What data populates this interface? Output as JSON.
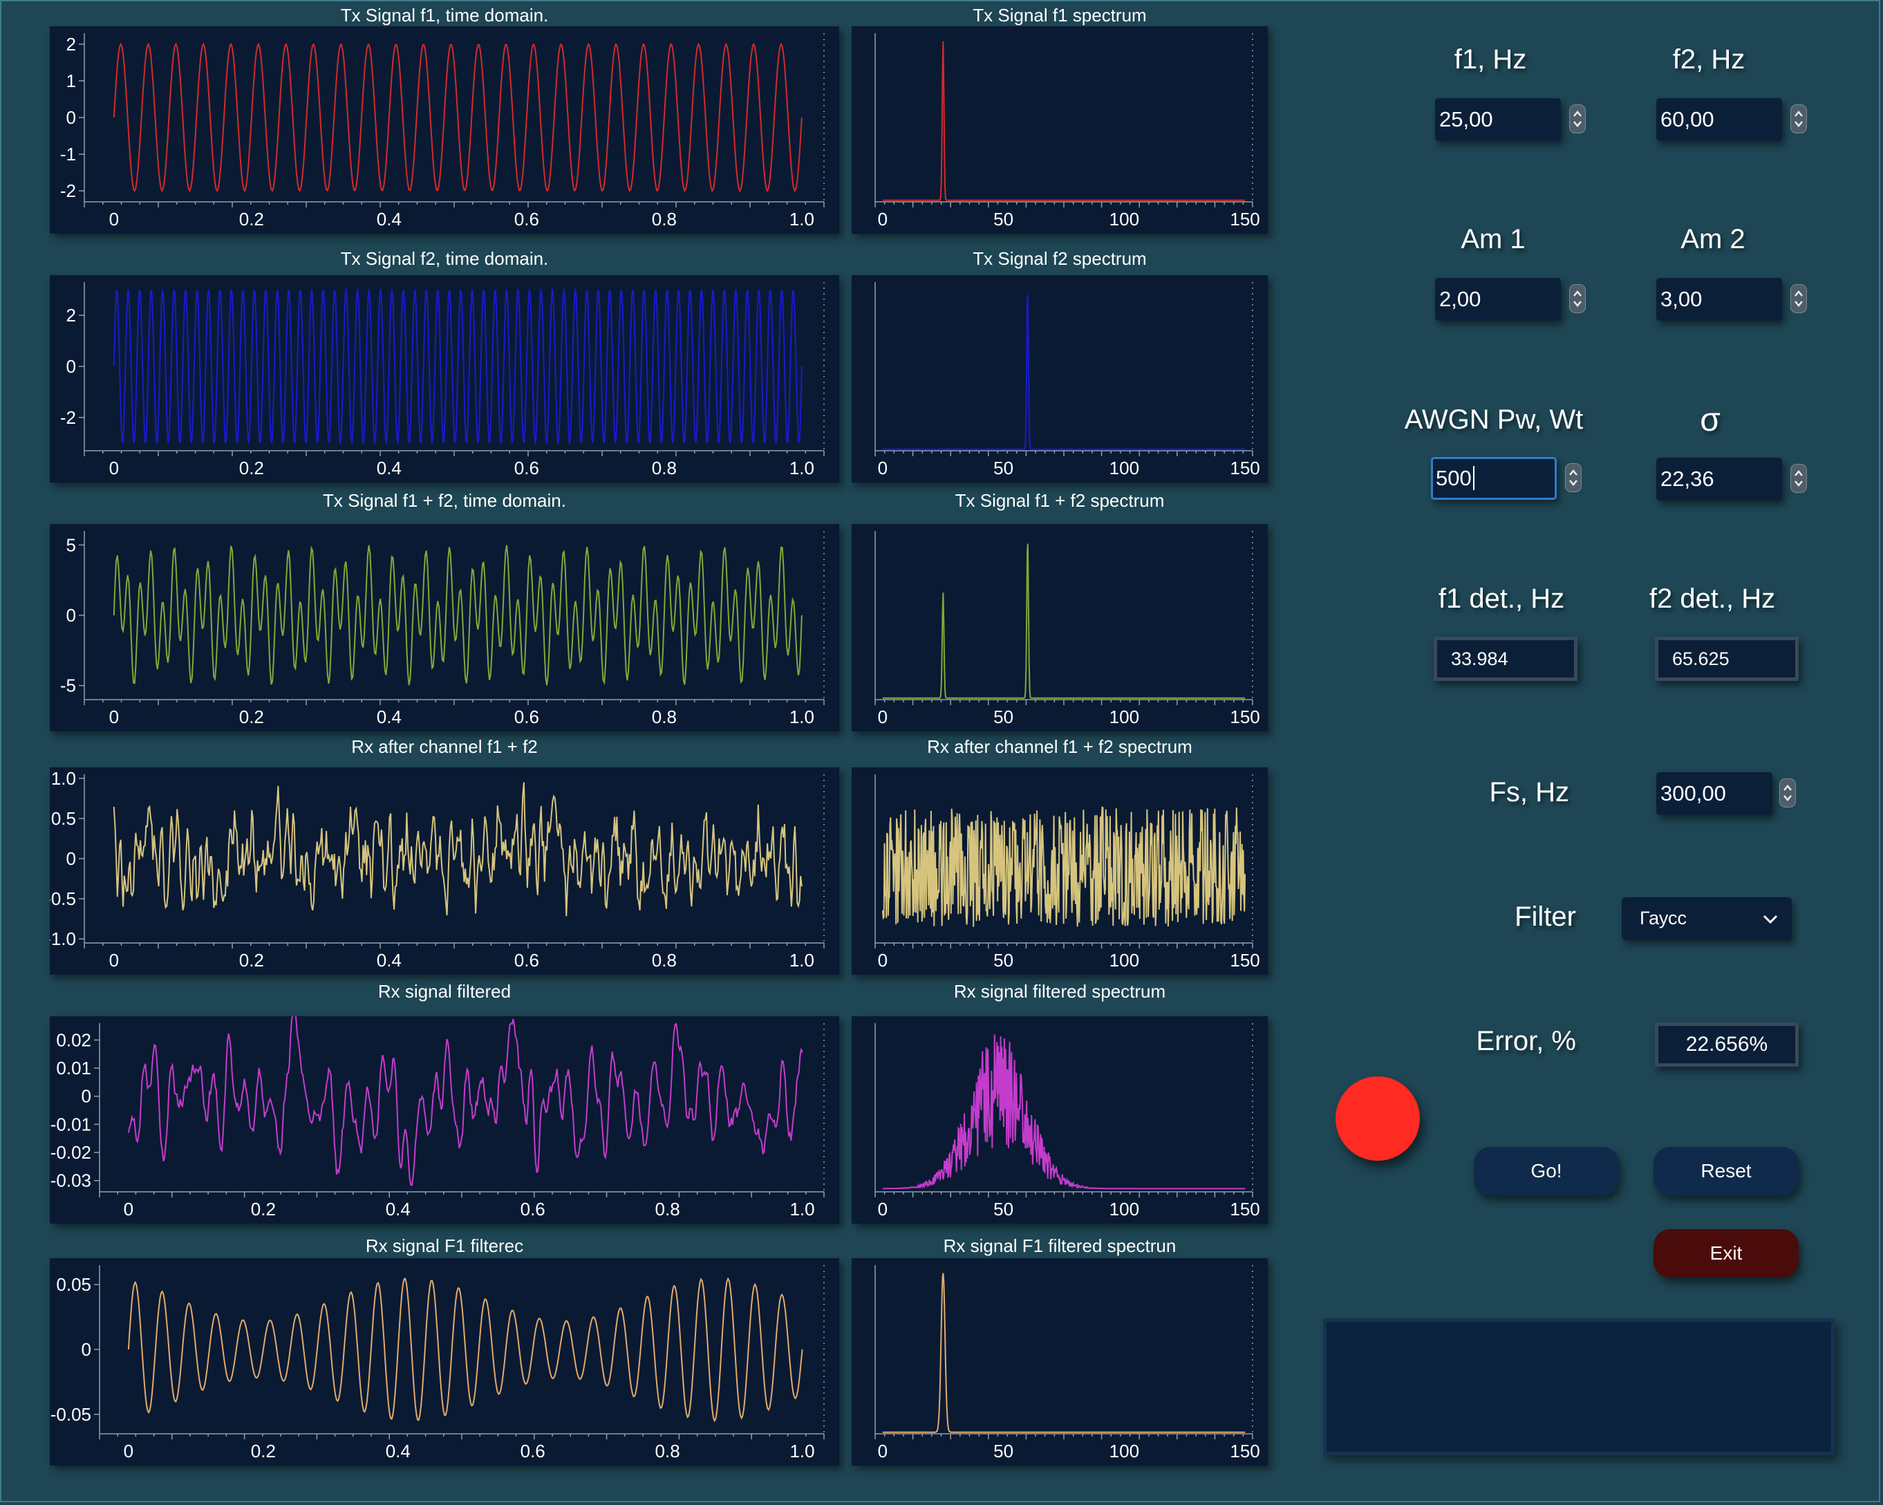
{
  "plots": [
    {
      "id": "f1-time",
      "title": "Tx Signal f1, time domain.",
      "kind": "time",
      "color": "#d42a2a",
      "ylim": [
        -2.3,
        2.3
      ],
      "yticks": [
        "2",
        "1",
        "0",
        "-1",
        "-2"
      ],
      "ytick_values": [
        2,
        1,
        0,
        -1,
        -2
      ],
      "xticks": [
        "0",
        "0.2",
        "0.4",
        "0.6",
        "0.8",
        "1.0"
      ]
    },
    {
      "id": "f1-spec",
      "title": "Tx Signal f1 spectrum",
      "kind": "spec",
      "color": "#d42a2a",
      "xticks": [
        "0",
        "50",
        "100",
        "150"
      ]
    },
    {
      "id": "f2-time",
      "title": "Tx Signal f2, time domain.",
      "kind": "time",
      "color": "#1a1acc",
      "ylim": [
        -3.3,
        3.3
      ],
      "yticks": [
        "2",
        "0",
        "-2"
      ],
      "ytick_values": [
        2,
        0,
        -2
      ],
      "xticks": [
        "0",
        "0.2",
        "0.4",
        "0.6",
        "0.8",
        "1.0"
      ]
    },
    {
      "id": "f2-spec",
      "title": "Tx Signal f2 spectrum",
      "kind": "spec",
      "color": "#1a1acc",
      "xticks": [
        "0",
        "50",
        "100",
        "150"
      ]
    },
    {
      "id": "sum-time",
      "title": "Tx Signal f1 + f2, time domain.",
      "kind": "time",
      "color": "#7faa35",
      "ylim": [
        -6,
        6
      ],
      "yticks": [
        "5",
        "0",
        "-5"
      ],
      "ytick_values": [
        5,
        0,
        -5
      ],
      "xticks": [
        "0",
        "0.2",
        "0.4",
        "0.6",
        "0.8",
        "1.0"
      ]
    },
    {
      "id": "sum-spec",
      "title": "Tx Signal f1 + f2 spectrum",
      "kind": "spec",
      "color": "#7faa35",
      "xticks": [
        "0",
        "50",
        "100",
        "150"
      ]
    },
    {
      "id": "rx-time",
      "title": "Rx after channel f1 + f2",
      "kind": "time",
      "color": "#d6c47e",
      "ylim": [
        -1.05,
        1.05
      ],
      "yticks": [
        "1.0",
        "0.5",
        "0",
        "-0.5",
        "-1.0"
      ],
      "ytick_values": [
        1,
        0.5,
        0,
        -0.5,
        -1
      ],
      "xticks": [
        "0",
        "0.2",
        "0.4",
        "0.6",
        "0.8",
        "1.0"
      ]
    },
    {
      "id": "rx-spec",
      "title": "Rx after channel f1 + f2 spectrum",
      "kind": "spec",
      "color": "#d6c47e",
      "xticks": [
        "0",
        "50",
        "100",
        "150"
      ]
    },
    {
      "id": "filt-time",
      "title": "Rx signal filtered",
      "kind": "time",
      "color": "#c43ccc",
      "ylim": [
        -0.034,
        0.026
      ],
      "yticks": [
        "0.02",
        "0.01",
        "0",
        "-0.01",
        "-0.02",
        "-0.03"
      ],
      "ytick_values": [
        0.02,
        0.01,
        0,
        -0.01,
        -0.02,
        -0.03
      ],
      "xticks": [
        "0",
        "0.2",
        "0.4",
        "0.6",
        "0.8",
        "1.0"
      ]
    },
    {
      "id": "filt-spec",
      "title": "Rx signal filtered spectrum",
      "kind": "spec",
      "color": "#c43ccc",
      "xticks": [
        "0",
        "50",
        "100",
        "150"
      ]
    },
    {
      "id": "f1f-time",
      "title": "Rx signal F1 filterec",
      "kind": "time",
      "color": "#e3aa6a",
      "ylim": [
        -0.065,
        0.065
      ],
      "yticks": [
        "0.05",
        "0",
        "-0.05"
      ],
      "ytick_values": [
        0.05,
        0,
        -0.05
      ],
      "xticks": [
        "0",
        "0.2",
        "0.4",
        "0.6",
        "0.8",
        "1.0"
      ]
    },
    {
      "id": "f1f-spec",
      "title": "Rx signal F1 filtered spectrun",
      "kind": "spec",
      "color": "#e3aa6a",
      "xticks": [
        "0",
        "50",
        "100",
        "150"
      ]
    }
  ],
  "controls": {
    "f1": {
      "label": "f1, Hz",
      "value": "25,00"
    },
    "f2": {
      "label": "f2, Hz",
      "value": "60,00"
    },
    "am1": {
      "label": "Am 1",
      "value": "2,00"
    },
    "am2": {
      "label": "Am 2",
      "value": "3,00"
    },
    "awgn": {
      "label": "AWGN Pw, Wt",
      "value": "500"
    },
    "sigma": {
      "label": "σ",
      "value": "22,36"
    },
    "f1det": {
      "label": "f1 det., Hz",
      "value": "33.984"
    },
    "f2det": {
      "label": "f2 det., Hz",
      "value": "65.625"
    },
    "fs": {
      "label": "Fs, Hz",
      "value": "300,00"
    },
    "filter": {
      "label": "Filter",
      "value": "Гаусс"
    },
    "error": {
      "label": "Error,  %",
      "value": "22.656%"
    }
  },
  "buttons": {
    "go": "Go!",
    "reset": "Reset",
    "exit": "Exit"
  },
  "colors": {
    "background": "#1e4654",
    "plot_bg": "#0a1a33",
    "indicator": "#ff2a22"
  }
}
